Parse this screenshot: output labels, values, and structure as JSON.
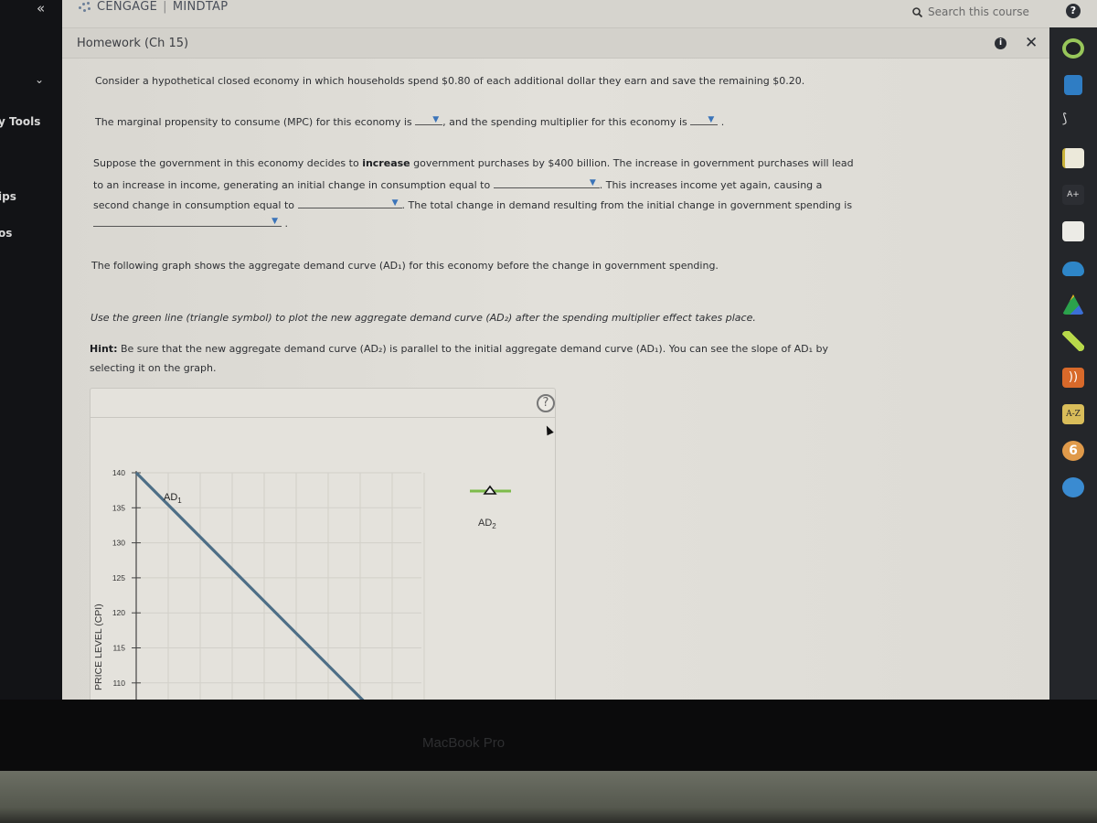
{
  "app": {
    "brand": "CENGAGE",
    "product": "MINDTAP",
    "search_placeholder": "Search this course",
    "help_label": "?",
    "breadcrumb": "Homework (Ch 15)",
    "info_label": "i",
    "close_label": "✕",
    "collapse_label": "«",
    "chevron_label": "⌄"
  },
  "leftnav": {
    "items": [
      {
        "label": "y Tools"
      },
      {
        "label": "ips"
      },
      {
        "label": "os"
      }
    ]
  },
  "dock": {
    "icons": [
      "progress-ring-icon",
      "notebook-icon",
      "kaltura-icon",
      "notes-icon",
      "aplus-icon",
      "flashcards-icon",
      "cloud-icon",
      "google-drive-icon",
      "highlighter-icon",
      "rss-icon",
      "glossary-icon",
      "readspeaker-icon",
      "cengage-icon"
    ],
    "glossary_label": "A-Z",
    "aplus_label": "A+"
  },
  "question": {
    "intro": "Consider a hypothetical closed economy in which households spend $0.80 of each additional dollar they earn and save the remaining $0.20.",
    "mpc_before": "The marginal propensity to consume (MPC) for this economy is",
    "mpc_mid": ", and the spending multiplier for this economy is",
    "mpc_after": ".",
    "gov_line1_a": "Suppose the government in this economy decides to",
    "gov_line1_bold": "increase",
    "gov_line1_b": "government purchases by $400 billion. The increase in government purchases will lead",
    "gov_line2_a": "to an increase in income, generating an initial change in consumption equal to",
    "gov_line2_b": ". This increases income yet again, causing a",
    "gov_line3_a": "second change in consumption equal to",
    "gov_line3_b": ". The total change in demand resulting from the initial change in government spending is",
    "gov_line4_after": ".",
    "graph_intro": "The following graph shows the aggregate demand curve (AD₁) for this economy before the change in government spending.",
    "instruction": "Use the green line (triangle symbol) to plot the new aggregate demand curve (AD₂) after the spending multiplier effect takes place.",
    "hint_label": "Hint:",
    "hint_text": "Be sure that the new aggregate demand curve (AD₂) is parallel to the initial aggregate demand curve (AD₁). You can see the slope of AD₁ by",
    "hint_text2": "selecting it on the graph.",
    "dropdowns": {
      "mpc": "",
      "multiplier": "",
      "initial_consumption_change": "",
      "second_consumption_change": "",
      "total_demand_change": ""
    }
  },
  "graph": {
    "help_label": "?",
    "tool_label": "AD",
    "tool_sub": "2",
    "ad1_label": "AD",
    "ad1_sub": "1",
    "colors": {
      "ad1": "#4d6e86",
      "ad2_tool": "#7dbb4a",
      "grid": "#d2d0c9",
      "axis": "#444"
    }
  },
  "chart_data": {
    "type": "line",
    "title": "",
    "xlabel": "",
    "ylabel": "PRICE LEVEL (CPI)",
    "yticks": [
      140,
      135,
      130,
      125,
      120,
      115,
      110
    ],
    "ylim": [
      107,
      140
    ],
    "grid": true,
    "series": [
      {
        "name": "AD1",
        "points": [
          {
            "x": 0,
            "y": 140
          },
          {
            "x": 7.2,
            "y": 107
          }
        ]
      }
    ],
    "legend": [
      {
        "name": "AD2",
        "symbol": "triangle",
        "color": "#7dbb4a",
        "placement": "right"
      }
    ]
  },
  "bezel": {
    "label": "MacBook Pro"
  }
}
